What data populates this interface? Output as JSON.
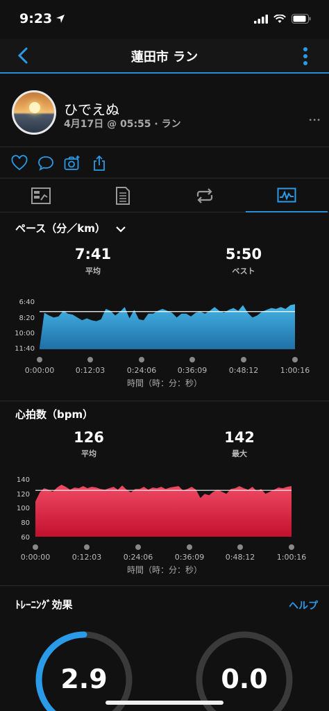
{
  "status": {
    "time": "9:23"
  },
  "nav": {
    "title": "蓮田市 ラン"
  },
  "profile": {
    "name": "ひでえぬ",
    "meta": "4月17日 @ 05:55 · ラン",
    "extra": "•••"
  },
  "icons": {
    "back": "chevron-left-icon",
    "more": "more-vertical-icon",
    "like": "heart-icon",
    "comment": "comment-icon",
    "photo": "camera-icon",
    "share": "share-icon",
    "tabs": [
      "summary-icon",
      "laps-icon",
      "loop-icon",
      "chart-icon"
    ]
  },
  "colors": {
    "accent": "#2a8fd6",
    "pace_fill": "#3aa4dc",
    "hr_fill": "#e0304a"
  },
  "pace": {
    "title": "ペース（分／km）",
    "avg_value": "7:41",
    "avg_label": "平均",
    "best_value": "5:50",
    "best_label": "ベスト"
  },
  "heart": {
    "title": "心拍数（bpm）",
    "avg_value": "126",
    "avg_label": "平均",
    "max_value": "142",
    "max_label": "最大"
  },
  "xaxis_label": "時間（時：分：秒）",
  "training": {
    "title": "ﾄﾚｰﾆﾝｸﾞ効果",
    "help": "ヘルプ",
    "aerobic": "2.9",
    "anaerobic": "0.0"
  },
  "chart_data": [
    {
      "type": "area",
      "name": "pace",
      "x_ticks": [
        "0:00:00",
        "0:12:03",
        "0:24:06",
        "0:36:09",
        "0:48:12",
        "1:00:16"
      ],
      "y_ticks": [
        "6:40",
        "8:20",
        "10:00",
        "11:40"
      ],
      "y_range_min": [
        6.67,
        11.67
      ],
      "avg_min": 7.68,
      "x_max_min": 60.27,
      "values_min": [
        11.5,
        7.8,
        8.1,
        8.3,
        8.2,
        7.6,
        7.9,
        8.0,
        8.3,
        8.6,
        8.4,
        8.6,
        8.7,
        8.5,
        7.4,
        7.6,
        8.1,
        7.7,
        7.2,
        8.4,
        7.5,
        8.5,
        8.6,
        7.9,
        7.9,
        7.6,
        7.4,
        7.6,
        7.8,
        8.3,
        7.9,
        7.9,
        8.2,
        7.8,
        7.7,
        7.9,
        7.6,
        7.2,
        7.6,
        7.8,
        7.5,
        7.3,
        7.6,
        7.0,
        7.8,
        8.3,
        8.1,
        7.7,
        7.5,
        7.3,
        7.4,
        7.2,
        7.4,
        7.0,
        6.9
      ]
    },
    {
      "type": "area",
      "name": "heart_rate",
      "x_ticks": [
        "0:00:00",
        "0:12:03",
        "0:24:06",
        "0:36:09",
        "0:48:12",
        "1:00:16"
      ],
      "y_ticks": [
        "140",
        "120",
        "100",
        "80",
        "60"
      ],
      "y_range_bpm": [
        60,
        140
      ],
      "avg_bpm": 126,
      "x_max_min": 60.27,
      "values_bpm": [
        110,
        123,
        129,
        127,
        124,
        130,
        134,
        131,
        127,
        130,
        129,
        132,
        129,
        131,
        130,
        128,
        127,
        129,
        131,
        127,
        133,
        127,
        123,
        128,
        128,
        131,
        127,
        130,
        129,
        131,
        128,
        130,
        131,
        132,
        126,
        128,
        131,
        127,
        115,
        121,
        119,
        124,
        127,
        124,
        121,
        128,
        129,
        132,
        129,
        127,
        131,
        125,
        128,
        121,
        124,
        127,
        130,
        129,
        131,
        132
      ]
    }
  ]
}
